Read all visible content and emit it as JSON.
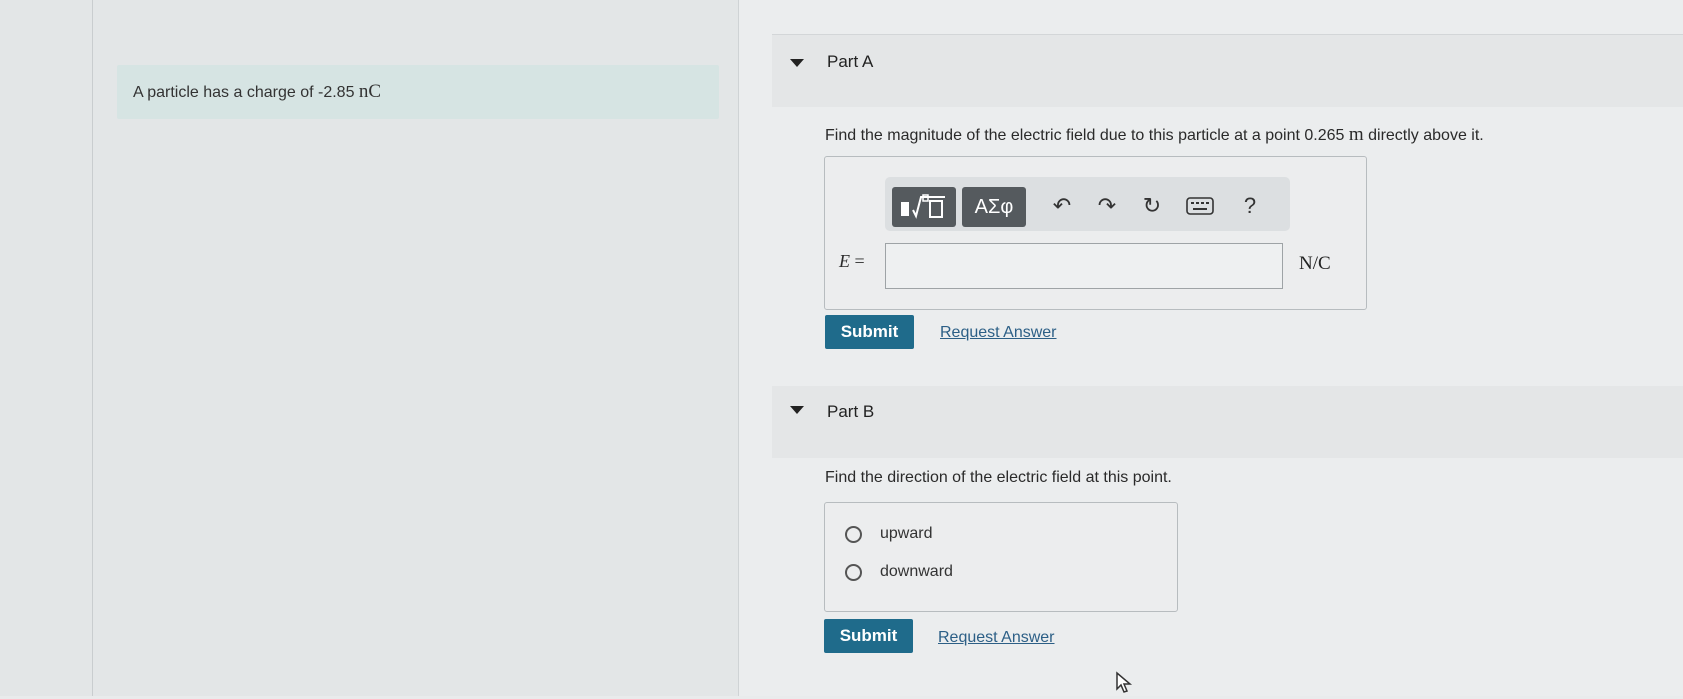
{
  "problem": {
    "intro_prefix": "A particle has a charge of -2.85",
    "intro_unit": "nC"
  },
  "part_a": {
    "title": "Part A",
    "question_prefix": "Find the magnitude of the electric field due to this particle at a point 0.265",
    "question_unit": "m",
    "question_suffix": "directly above it.",
    "toolbar": {
      "greek_label": "ΑΣφ",
      "help_label": "?"
    },
    "equation_var": "E",
    "equation_eq": "=",
    "answer_value": "",
    "unit": "N/C",
    "submit_label": "Submit",
    "request_label": "Request Answer"
  },
  "part_b": {
    "title": "Part B",
    "question": "Find the direction of the electric field at this point.",
    "options": [
      {
        "label": "upward"
      },
      {
        "label": "downward"
      }
    ],
    "submit_label": "Submit",
    "request_label": "Request Answer"
  }
}
